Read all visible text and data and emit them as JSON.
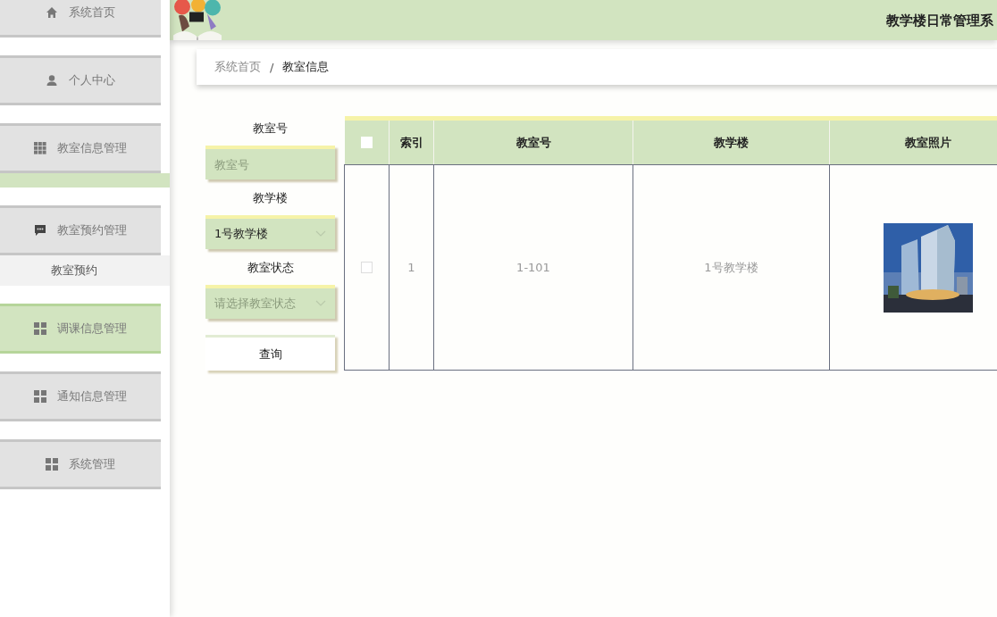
{
  "sidebar": {
    "items": [
      {
        "label": "系统首页",
        "kind": "home",
        "selected": false,
        "expanded": false
      },
      {
        "label": "个人中心",
        "kind": "person",
        "selected": false,
        "expanded": false
      },
      {
        "label": "教室信息管理",
        "kind": "grid9",
        "selected": false,
        "expanded": true
      },
      {
        "label": "教室预约管理",
        "kind": "chat",
        "selected": false,
        "expanded": true,
        "children": [
          {
            "label": "教室预约"
          }
        ]
      },
      {
        "label": "调课信息管理",
        "kind": "grid4",
        "selected": true,
        "expanded": false
      },
      {
        "label": "通知信息管理",
        "kind": "grid4",
        "selected": false,
        "expanded": false
      },
      {
        "label": "系统管理",
        "kind": "grid4",
        "selected": false,
        "expanded": false
      }
    ]
  },
  "header": {
    "title": "教学楼日常管理系"
  },
  "breadcrumb": {
    "separator": "/",
    "items": [
      "系统首页",
      "教室信息"
    ]
  },
  "search": {
    "fields": [
      {
        "label": "教室号",
        "kind": "input",
        "placeholder": "教室号"
      },
      {
        "label": "教学楼",
        "kind": "select",
        "value": "1号教学楼"
      },
      {
        "label": "教室状态",
        "kind": "select",
        "placeholder": "请选择教室状态"
      }
    ],
    "button": "查询"
  },
  "table": {
    "header_checked": false,
    "columns": [
      "索引",
      "教室号",
      "教学楼",
      "教室照片"
    ],
    "rows": [
      {
        "checked": false,
        "cells": [
          "1",
          "1-101",
          "1号教学楼"
        ],
        "photo": {
          "kind": "picture"
        }
      }
    ]
  }
}
